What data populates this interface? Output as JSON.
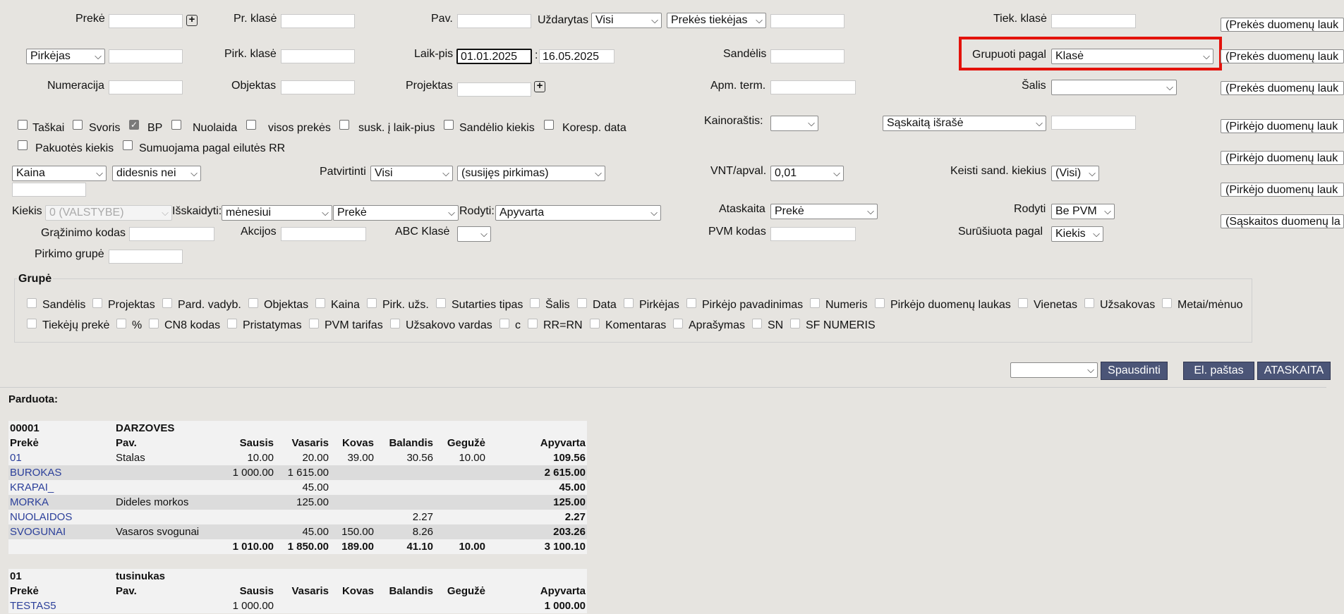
{
  "filters": {
    "preke": "Prekė",
    "pr_klase": "Pr. klasė",
    "pav": "Pav.",
    "uzdarytas": "Uždarytas",
    "uzdarytas_value": "Visi",
    "prekes_tiekejas": "Prekės tiekėjas",
    "tiek_klase": "Tiek. klasė",
    "pirkejas": "Pirkėjas",
    "pirk_klase": "Pirk. klasė",
    "laik_pis": "Laik-pis",
    "date_from": "01.01.2025",
    "date_sep": ":",
    "date_to": "16.05.2025",
    "sandelis": "Sandėlis",
    "grupuoti_pagal": "Grupuoti pagal",
    "grupuoti_value": "Klasė",
    "numeracija": "Numeracija",
    "objektas": "Objektas",
    "projektas": "Projektas",
    "apm_term": "Apm. term.",
    "salis": "Šalis",
    "kainorastis": "Kainoraštis:",
    "saskaita_israse": "Sąskaitą išrašė",
    "kaina": "Kaina",
    "didesnis_nei": "didesnis nei",
    "patvirtinti": "Patvirtinti",
    "patvirtinti_value": "Visi",
    "susijes_pirkimas": "(susijęs pirkimas)",
    "vnt_apval": "VNT/apval.",
    "vnt_value": "0,01",
    "keisti_sand": "Keisti sand. kiekius",
    "keisti_value": "(Visi)",
    "kiekis": "Kiekis",
    "kiekis_value": "0 (VALSTYBE)",
    "isskaidyti": "Išskaidyti:",
    "isskaidyti_value": "mėnesiui",
    "isskaidyti_value2": "Prekė",
    "rodyti": "Rodyti:",
    "rodyti_value": "Apyvarta",
    "ataskaita": "Ataskaita",
    "ataskaita_value": "Prekė",
    "rodyti2": "Rodyti",
    "rodyti2_value": "Be PVM",
    "grazinimo_kodas": "Grąžinimo kodas",
    "akcijos": "Akcijos",
    "abc_klase": "ABC Klasė",
    "pvm_kodas": "PVM kodas",
    "surusiuota": "Surūšiuota pagal",
    "surusiuota_value": "Kiekis",
    "pirkimo_grupe": "Pirkimo grupė"
  },
  "checks": {
    "taskai": "Taškai",
    "svoris": "Svoris",
    "bp": "BP",
    "nuolaida": "Nuolaida",
    "visos_prekes": "visos prekės",
    "susk": "susk. į laik-pius",
    "sandelio_kiekis": "Sandėlio kiekis",
    "koresp_data": "Koresp. data",
    "pakuotes_kiekis": "Pakuotės kiekis",
    "sumuojama": "Sumuojama pagal eilutės RR"
  },
  "right_fields": [
    "(Prekės duomenų lauk",
    "(Prekės duomenų lauk",
    "(Prekės duomenų lauk",
    "(Pirkėjo duomenų lauk",
    "(Pirkėjo duomenų lauk",
    "(Pirkėjo duomenų lauk",
    "(Sąskaitos duomenų la"
  ],
  "grupe": {
    "title": "Grupė",
    "row1": [
      "Sandėlis",
      "Projektas",
      "Pard. vadyb.",
      "Objektas",
      "Kaina",
      "Pirk. užs.",
      "Sutarties tipas",
      "Šalis",
      "Data",
      "Pirkėjas",
      "Pirkėjo pavadinimas",
      "Numeris",
      "Pirkėjo duomenų laukas",
      "Vienetas",
      "Užsakovas",
      "Metai/mėnuo"
    ],
    "row2": [
      "Tiekėjų prekė",
      "%",
      "CN8 kodas",
      "Pristatymas",
      "PVM tarifas",
      "Užsakovo vardas",
      "c",
      "RR=RN",
      "Komentaras",
      "Aprašymas",
      "SN",
      "SF NUMERIS"
    ]
  },
  "buttons": {
    "print": "Spausdinti",
    "email": "El. paštas",
    "report": "ATASKAITA"
  },
  "report": {
    "title": "Parduota:",
    "headers": [
      "Prekė",
      "Pav.",
      "Sausis",
      "Vasaris",
      "Kovas",
      "Balandis",
      "Gegužė",
      "Apyvarta"
    ],
    "group1": {
      "code": "00001",
      "name": "DARZOVES",
      "rows": [
        [
          "01",
          "Stalas",
          "10.00",
          "20.00",
          "39.00",
          "30.56",
          "10.00",
          "109.56"
        ],
        [
          "BUROKAS",
          "",
          "1 000.00",
          "1 615.00",
          "",
          "",
          "",
          "2 615.00"
        ],
        [
          "KRAPAI_",
          "",
          "",
          "45.00",
          "",
          "",
          "",
          "45.00"
        ],
        [
          "MORKA",
          "Dideles morkos",
          "",
          "125.00",
          "",
          "",
          "",
          "125.00"
        ],
        [
          "NUOLAIDOS",
          "",
          "",
          "",
          "",
          "2.27",
          "",
          "2.27"
        ],
        [
          "SVOGUNAI",
          "Vasaros svogunai",
          "",
          "45.00",
          "150.00",
          "8.26",
          "",
          "203.26"
        ]
      ],
      "total": [
        "",
        "",
        "1 010.00",
        "1 850.00",
        "189.00",
        "41.10",
        "10.00",
        "3 100.10"
      ]
    },
    "group2": {
      "code": "01",
      "name": "tusinukas",
      "rows": [
        [
          "TESTAS5",
          "",
          "1 000.00",
          "",
          "",
          "",
          "",
          "1 000.00"
        ]
      ]
    }
  }
}
